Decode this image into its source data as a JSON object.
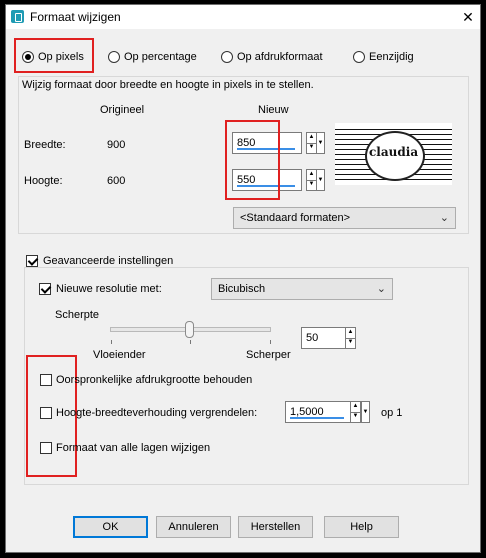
{
  "window": {
    "title": "Formaat wijzigen",
    "close_glyph": "✕"
  },
  "mode": {
    "options": [
      {
        "label": "Op pixels",
        "selected": true
      },
      {
        "label": "Op percentage",
        "selected": false
      },
      {
        "label": "Op afdrukformaat",
        "selected": false
      },
      {
        "label": "Eenzijdig",
        "selected": false
      }
    ]
  },
  "pixels": {
    "description": "Wijzig formaat door breedte en hoogte in pixels in te stellen.",
    "col_original": "Origineel",
    "col_new": "Nieuw",
    "width_label": "Breedte:",
    "width_original": "900",
    "width_new": "850",
    "height_label": "Hoogte:",
    "height_original": "600",
    "height_new": "550",
    "preset_select": "<Standaard formaten>",
    "preview_text": "claudia"
  },
  "advanced": {
    "label": "Geavanceerde instellingen",
    "checked": true,
    "resample_label": "Nieuwe resolutie met:",
    "resample_checked": true,
    "resample_value": "Bicubisch",
    "sharpness_label": "Scherpte",
    "slider_min_label": "Vloeiender",
    "slider_max_label": "Scherper",
    "sharpness_value": "50",
    "sharpness_level": 50,
    "keep_print_size": "Oorspronkelijke afdrukgrootte behouden",
    "lock_aspect": "Hoogte-breedteverhouding vergrendelen:",
    "aspect_value": "1,5000",
    "aspect_suffix": "op 1",
    "resize_all_layers": "Formaat van alle lagen wijzigen"
  },
  "buttons": {
    "ok": "OK",
    "cancel": "Annuleren",
    "reset": "Herstellen",
    "help": "Help"
  },
  "colors": {
    "accent": "#0078d7",
    "highlight": "#e02020",
    "underline": "#3a8ee6"
  },
  "icons": {
    "app": "resize-app-icon",
    "close": "close-icon",
    "dropdown": "chevron-down-icon"
  }
}
